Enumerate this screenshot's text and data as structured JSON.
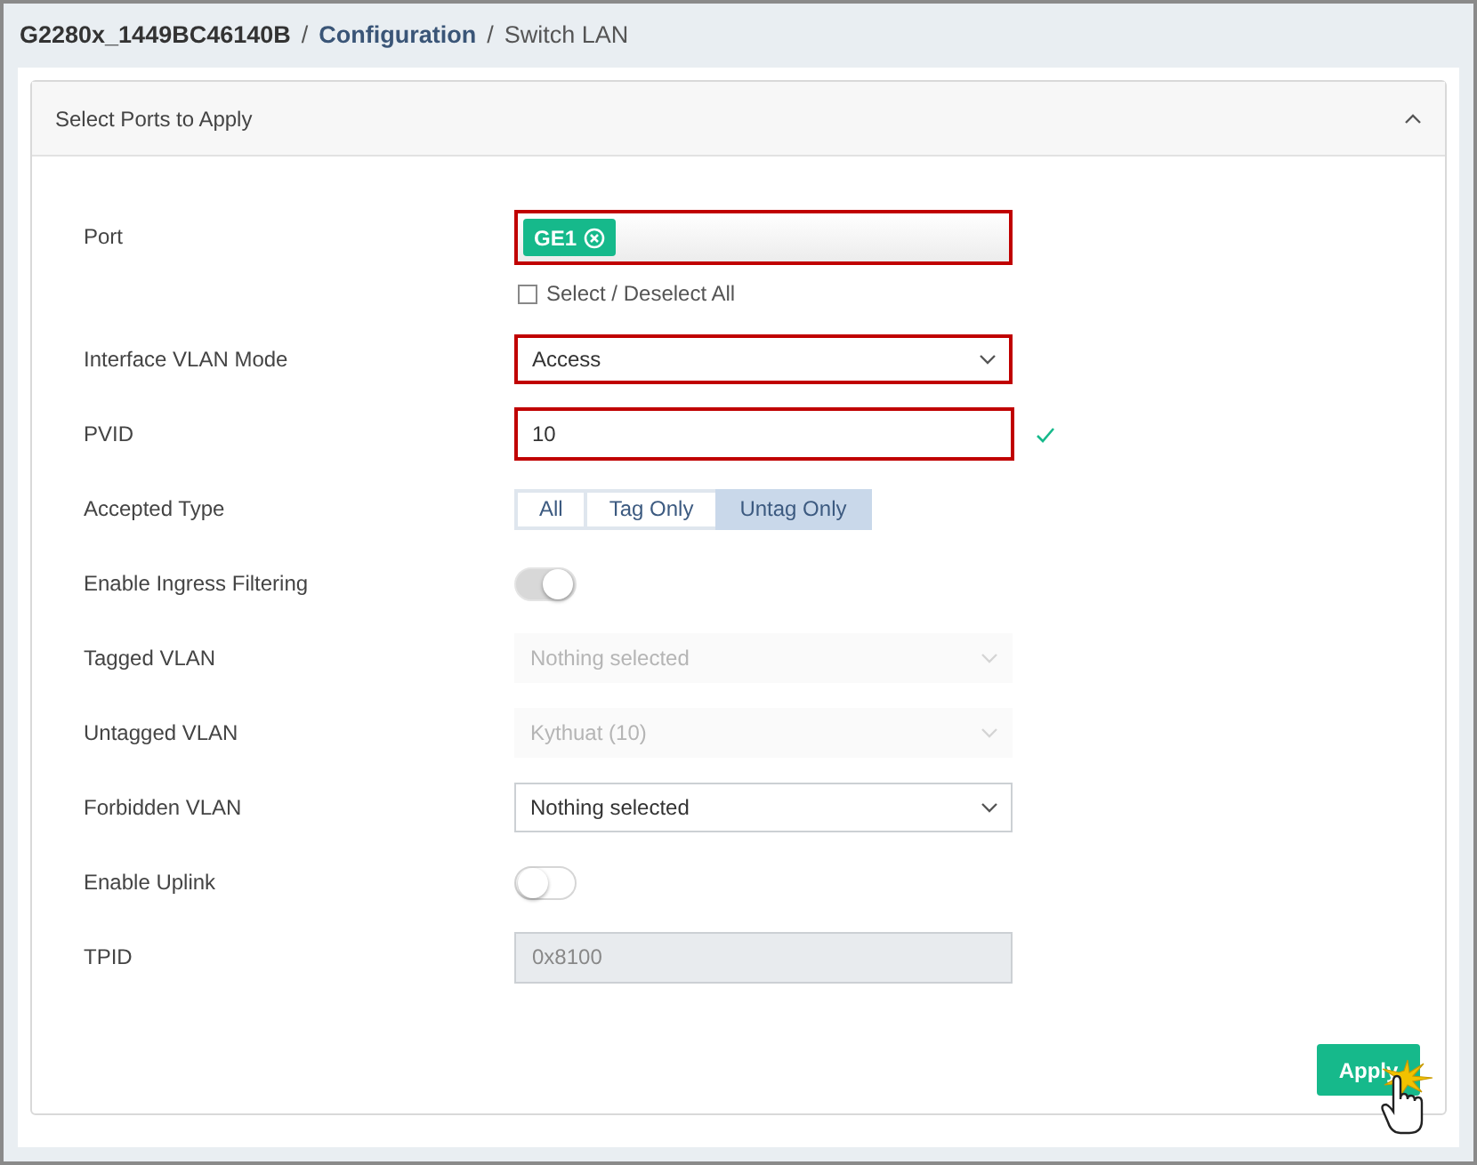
{
  "breadcrumb": [
    {
      "label": "G2280x_1449BC46140B",
      "kind": "device"
    },
    {
      "label": "Configuration",
      "kind": "link"
    },
    {
      "label": "Switch LAN",
      "kind": "current"
    }
  ],
  "breadcrumb_separator": "/",
  "panel": {
    "title": "Select Ports to Apply",
    "expanded": true
  },
  "fields": [
    {
      "label": "Port",
      "kind": "tags",
      "highlighted": true,
      "tags": [
        "GE1"
      ],
      "select_all": {
        "label": "Select / Deselect All",
        "checked": false
      }
    },
    {
      "label": "Interface VLAN Mode",
      "kind": "select",
      "highlighted": true,
      "disabled": false,
      "value": "Access"
    },
    {
      "label": "PVID",
      "kind": "text",
      "highlighted": true,
      "value": "10",
      "valid": true
    },
    {
      "label": "Accepted Type",
      "kind": "segmented",
      "options": [
        {
          "label": "All",
          "selected": false
        },
        {
          "label": "Tag Only",
          "selected": false
        },
        {
          "label": "Untag Only",
          "selected": true
        }
      ]
    },
    {
      "label": "Enable Ingress Filtering",
      "kind": "toggle",
      "on": true,
      "disabled": true
    },
    {
      "label": "Tagged VLAN",
      "kind": "select",
      "disabled": true,
      "value": "Nothing selected"
    },
    {
      "label": "Untagged VLAN",
      "kind": "select",
      "disabled": true,
      "value": "Kythuat (10)"
    },
    {
      "label": "Forbidden VLAN",
      "kind": "select",
      "highlighted": false,
      "disabled": false,
      "value": "Nothing selected"
    },
    {
      "label": "Enable Uplink",
      "kind": "toggle",
      "on": false
    },
    {
      "label": "TPID",
      "kind": "readonly",
      "value": "0x8100"
    }
  ],
  "apply_button": {
    "label": "Apply"
  }
}
